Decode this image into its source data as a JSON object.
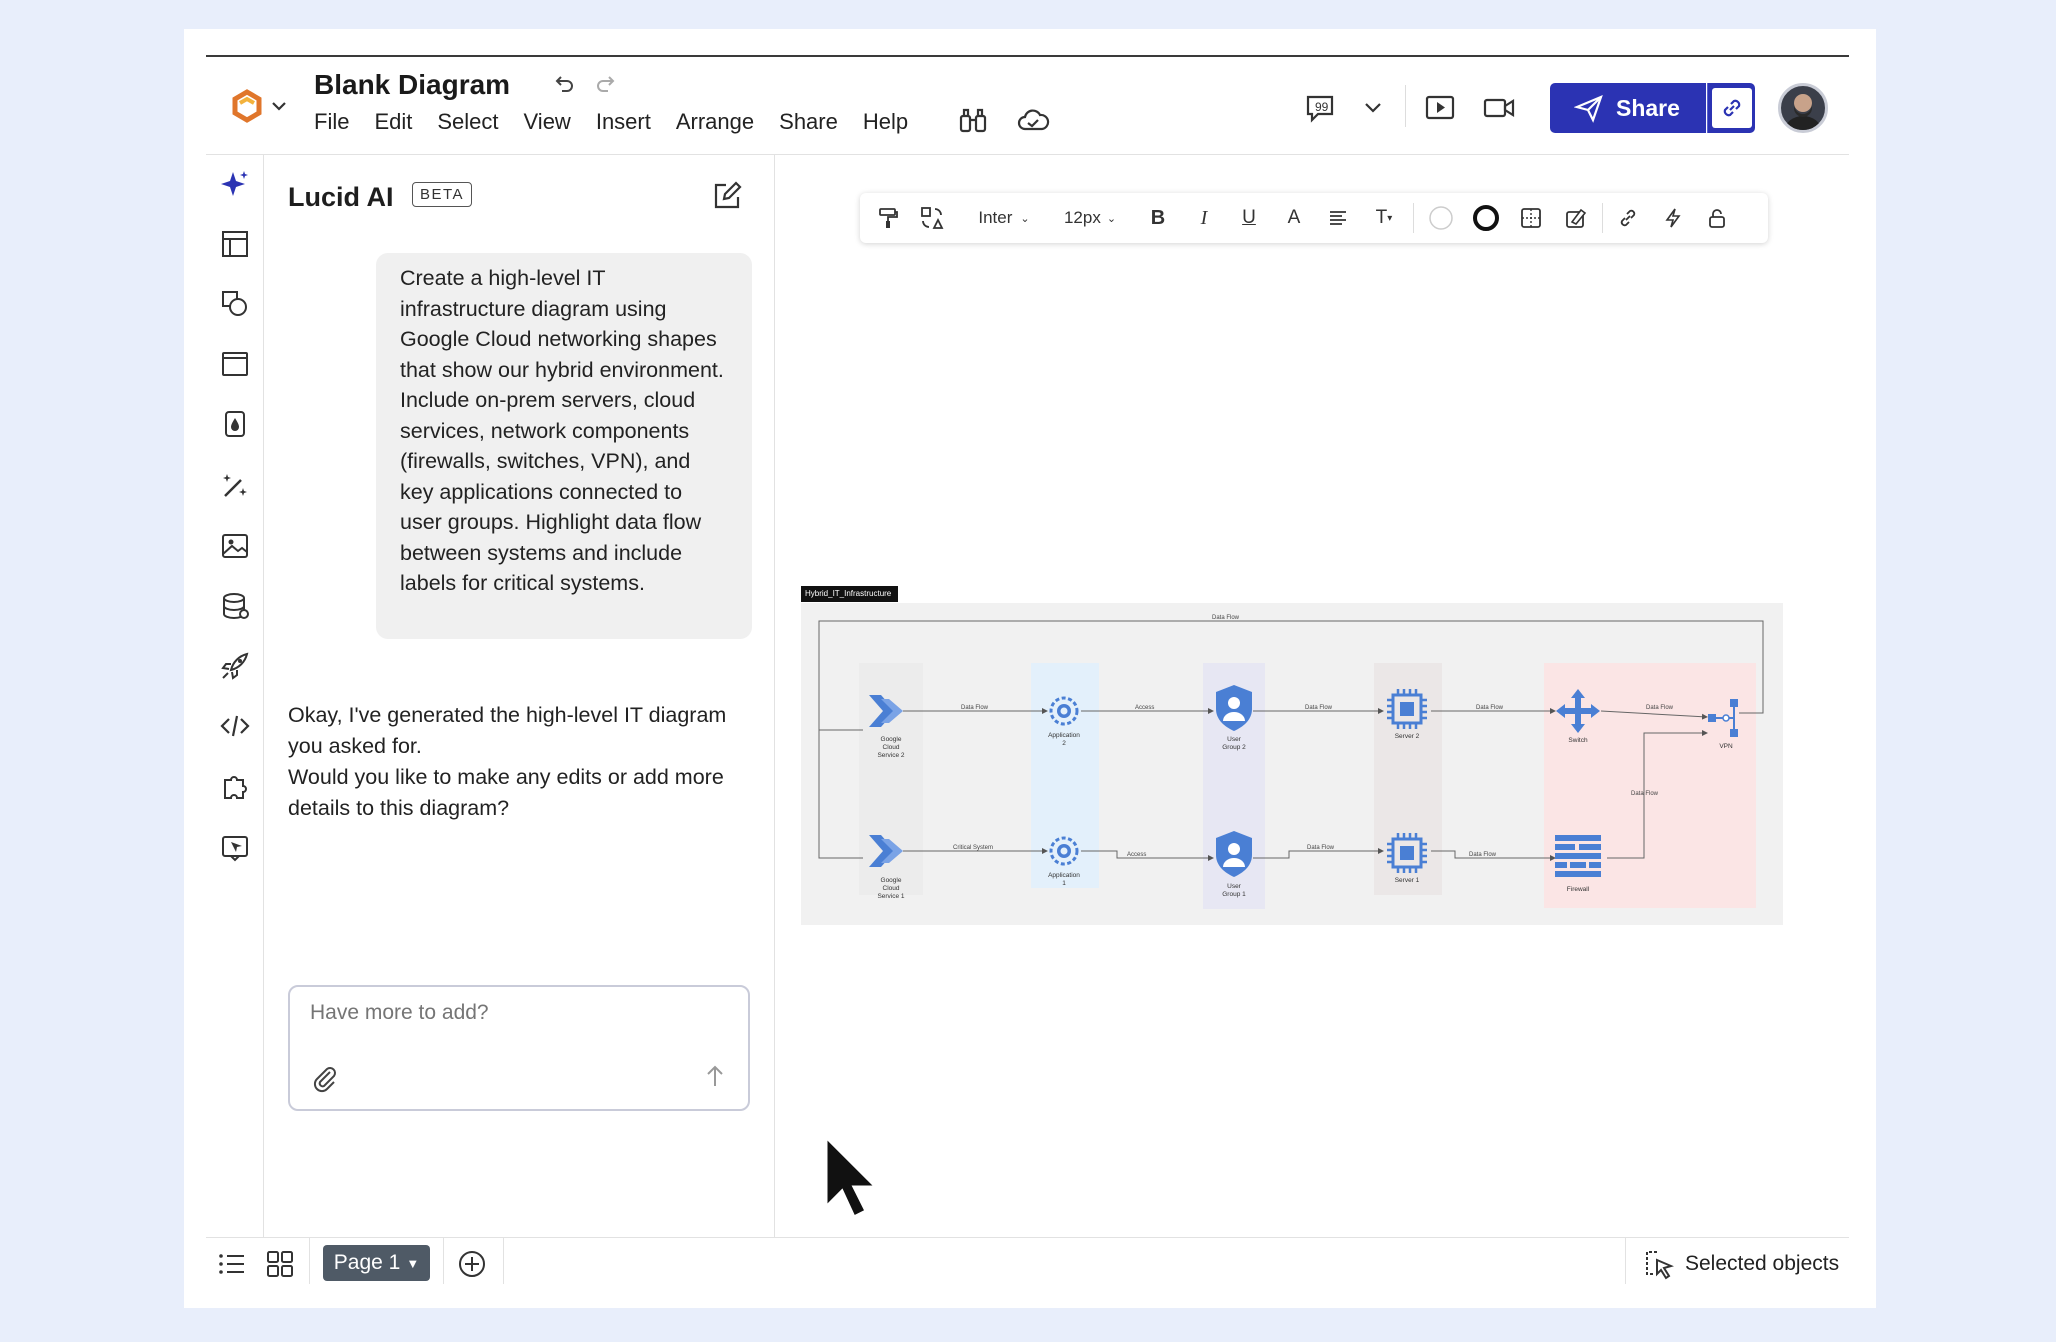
{
  "header": {
    "doc_title": "Blank Diagram",
    "menu": [
      "File",
      "Edit",
      "Select",
      "View",
      "Insert",
      "Arrange",
      "Share",
      "Help"
    ],
    "share_label": "Share"
  },
  "ai_panel": {
    "title": "Lucid AI",
    "badge": "BETA",
    "user_prompt": "Create a high-level IT infrastructure diagram using Google Cloud networking shapes that show our hybrid environment. Include on-prem servers, cloud services, network components (firewalls, switches, VPN), and key applications connected to user groups. Highlight data flow between systems and include labels for critical systems.",
    "ai_response_line1": "Okay, I've generated the high-level IT diagram you asked for.",
    "ai_response_line2": "Would you like to make any edits or add more details to this diagram?",
    "input_placeholder": "Have more to add?"
  },
  "format_toolbar": {
    "font": "Inter",
    "font_size": "12px"
  },
  "diagram": {
    "tag": "Hybrid_IT_Infrastructure",
    "top_flow_label": "Data Flow",
    "nodes": {
      "gcs2": [
        "Google",
        "Cloud",
        "Service 2"
      ],
      "gcs1": [
        "Google",
        "Cloud",
        "Service 1"
      ],
      "app2": [
        "Application",
        "2"
      ],
      "app1": [
        "Application",
        "1"
      ],
      "ug2": [
        "User",
        "Group 2"
      ],
      "ug1": [
        "User",
        "Group 1"
      ],
      "srv2": [
        "Server 2"
      ],
      "srv1": [
        "Server 1"
      ],
      "switch": [
        "Switch"
      ],
      "firewall": [
        "Firewall"
      ],
      "vpn": [
        "VPN"
      ]
    },
    "edges": {
      "gcs2_app2": "Data Flow",
      "app2_ug2": "Access",
      "ug2_srv2": "Data Flow",
      "srv2_switch": "Data Flow",
      "switch_vpn": "Data Flow",
      "firewall_vpn": "Data Flow",
      "gcs1_app1": "Critical System",
      "app1_ug1": "Access",
      "ug1_srv1": "Data Flow",
      "srv1_firewall": "Data Flow"
    },
    "colors": {
      "gcp_blue": "#4a7fd4",
      "app_lane": "#e3f0fb",
      "user_lane": "#e7e7f3",
      "server_lane": "#ebe7e7",
      "network_zone": "#fbe5e5"
    }
  },
  "bottom": {
    "page_label": "Page 1",
    "selected_label": "Selected objects"
  }
}
